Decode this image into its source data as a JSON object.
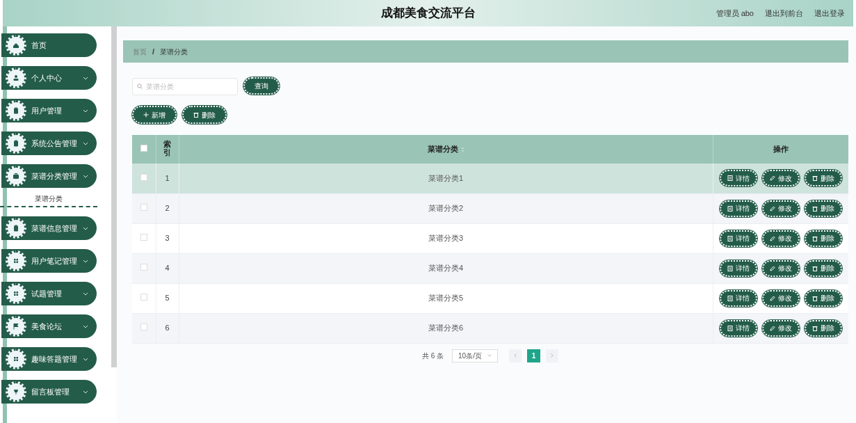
{
  "header": {
    "title": "成都美食交流平台",
    "user": "管理员 abo",
    "links": [
      "退出到前台",
      "退出登录"
    ]
  },
  "sidebar": {
    "items": [
      {
        "label": "首页",
        "expandable": false
      },
      {
        "label": "个人中心",
        "expandable": true
      },
      {
        "label": "用户管理",
        "expandable": true
      },
      {
        "label": "系统公告管理",
        "expandable": true
      },
      {
        "label": "菜谱分类管理",
        "expandable": true,
        "children": [
          {
            "label": "菜谱分类"
          }
        ]
      },
      {
        "label": "菜谱信息管理",
        "expandable": true
      },
      {
        "label": "用户笔记管理",
        "expandable": true
      },
      {
        "label": "试题管理",
        "expandable": true
      },
      {
        "label": "美食论坛",
        "expandable": true
      },
      {
        "label": "趣味答题管理",
        "expandable": true
      },
      {
        "label": "留言板管理",
        "expandable": true
      }
    ]
  },
  "breadcrumb": {
    "items": [
      "首页",
      "菜谱分类"
    ],
    "separator": "/"
  },
  "search": {
    "placeholder": "菜谱分类",
    "button": "查询"
  },
  "toolbar": [
    {
      "label": "新增",
      "kind": "add"
    },
    {
      "label": "删除",
      "kind": "delete"
    }
  ],
  "table": {
    "columns": [
      "索引",
      "菜谱分类",
      "操作"
    ],
    "header_checked": false,
    "rows": [
      {
        "index": "1",
        "name": "菜谱分类1",
        "checked": false,
        "hovered": true,
        "actions": [
          {
            "label": "详情",
            "kind": "detail"
          },
          {
            "label": "修改",
            "kind": "edit"
          },
          {
            "label": "删除",
            "kind": "delete"
          }
        ]
      },
      {
        "index": "2",
        "name": "菜谱分类2",
        "checked": false,
        "hovered": false,
        "actions": [
          {
            "label": "详情",
            "kind": "detail"
          },
          {
            "label": "修改",
            "kind": "edit"
          },
          {
            "label": "删除",
            "kind": "delete"
          }
        ]
      },
      {
        "index": "3",
        "name": "菜谱分类3",
        "checked": false,
        "hovered": false,
        "actions": [
          {
            "label": "详情",
            "kind": "detail"
          },
          {
            "label": "修改",
            "kind": "edit"
          },
          {
            "label": "删除",
            "kind": "delete"
          }
        ]
      },
      {
        "index": "4",
        "name": "菜谱分类4",
        "checked": false,
        "hovered": false,
        "actions": [
          {
            "label": "详情",
            "kind": "detail"
          },
          {
            "label": "修改",
            "kind": "edit"
          },
          {
            "label": "删除",
            "kind": "delete"
          }
        ]
      },
      {
        "index": "5",
        "name": "菜谱分类5",
        "checked": false,
        "hovered": false,
        "actions": [
          {
            "label": "详情",
            "kind": "detail"
          },
          {
            "label": "修改",
            "kind": "edit"
          },
          {
            "label": "删除",
            "kind": "delete"
          }
        ]
      },
      {
        "index": "6",
        "name": "菜谱分类6",
        "checked": false,
        "hovered": false,
        "actions": [
          {
            "label": "详情",
            "kind": "detail"
          },
          {
            "label": "修改",
            "kind": "edit"
          },
          {
            "label": "删除",
            "kind": "delete"
          }
        ]
      }
    ]
  },
  "pagination": {
    "total": "共 6 条",
    "page_size": "10条/页",
    "pages": [
      {
        "label": "1",
        "selected": true
      }
    ]
  }
}
